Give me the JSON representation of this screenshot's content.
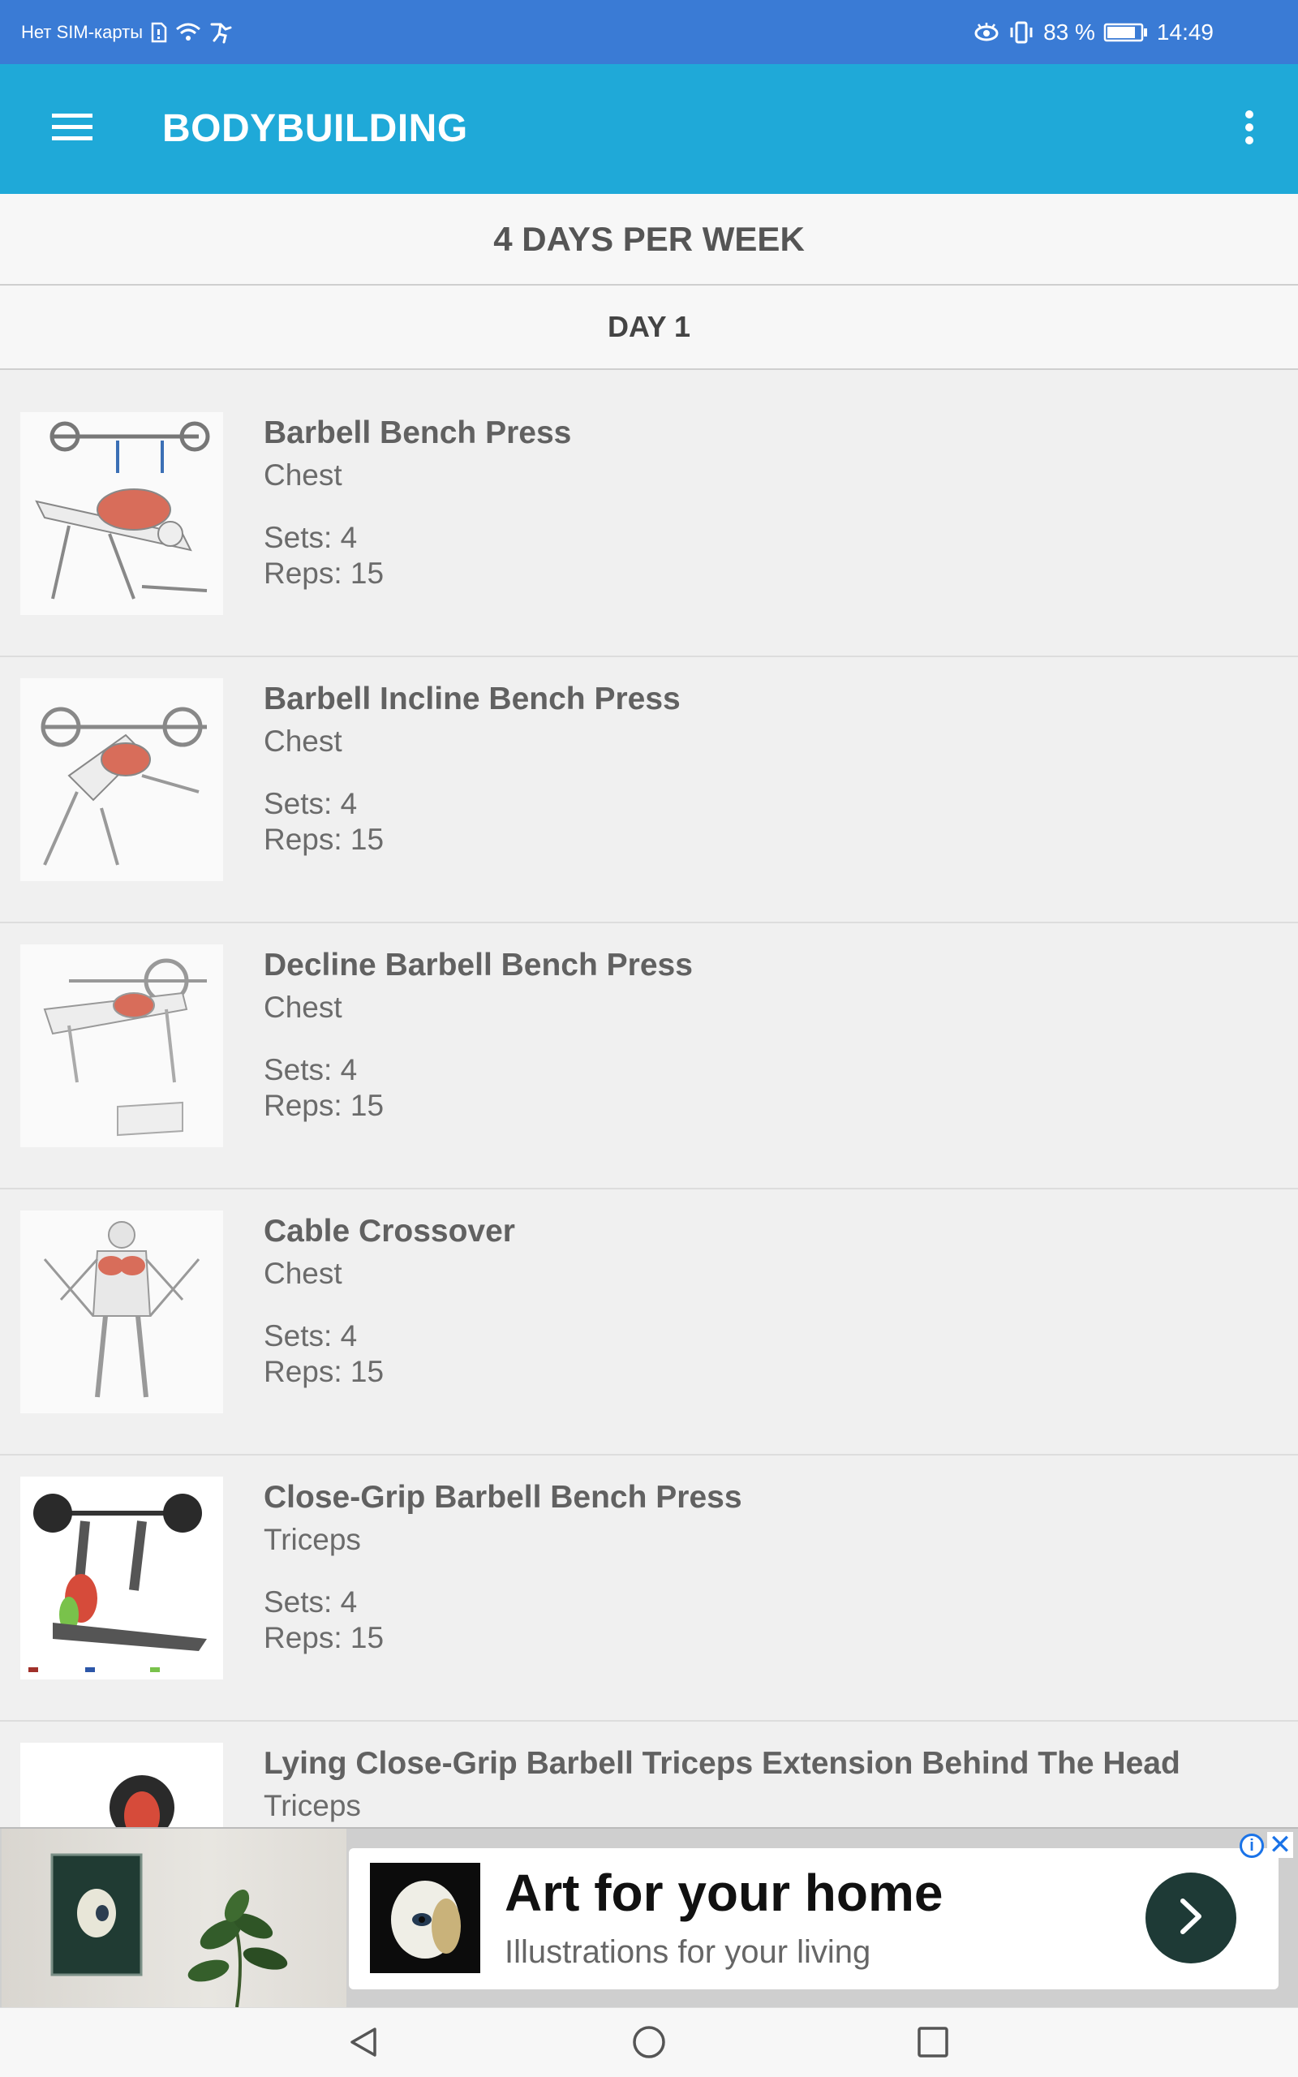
{
  "status_bar": {
    "carrier": "Нет SIM-карты",
    "battery": "83 %",
    "time": "14:49",
    "icons": [
      "sim-icon",
      "wifi-icon",
      "activity-icon",
      "eye-comfort-icon",
      "vibrate-icon",
      "battery-icon"
    ]
  },
  "app_bar": {
    "title": "BODYBUILDING",
    "color": "#1fa9d8"
  },
  "program": {
    "title": "4 DAYS PER WEEK"
  },
  "day": {
    "title": "DAY 1"
  },
  "exercises": [
    {
      "name": "Barbell Bench Press",
      "muscle": "Chest",
      "sets": "Sets: 4",
      "reps": "Reps: 15"
    },
    {
      "name": "Barbell Incline Bench Press",
      "muscle": "Chest",
      "sets": "Sets: 4",
      "reps": "Reps: 15"
    },
    {
      "name": "Decline Barbell Bench Press",
      "muscle": "Chest",
      "sets": "Sets: 4",
      "reps": "Reps: 15"
    },
    {
      "name": "Cable Crossover",
      "muscle": "Chest",
      "sets": "Sets: 4",
      "reps": "Reps: 15"
    },
    {
      "name": "Close-Grip Barbell Bench Press",
      "muscle": "Triceps",
      "sets": "Sets: 4",
      "reps": "Reps: 15"
    },
    {
      "name": "Lying Close-Grip Barbell Triceps Extension Behind The Head",
      "muscle": "Triceps",
      "sets": "",
      "reps": ""
    }
  ],
  "ad": {
    "title": "Art for your home",
    "subtitle": "Illustrations for your living",
    "info_symbol": "i",
    "close_symbol": "✕"
  }
}
